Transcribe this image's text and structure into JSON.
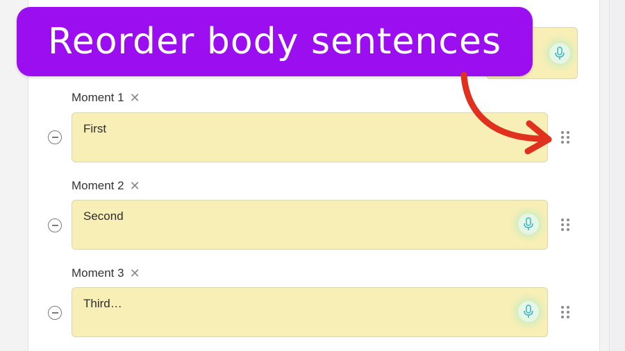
{
  "banner": {
    "title": "Reorder body sentences",
    "color": "#9b0ef0"
  },
  "moments": [
    {
      "label": "Moment 1",
      "text": "First",
      "has_mic": false
    },
    {
      "label": "Moment 2",
      "text": "Second",
      "has_mic": true
    },
    {
      "label": "Moment 3",
      "text": "Third…",
      "has_mic": true
    }
  ],
  "icons": {
    "remove": "close-icon",
    "delete": "minus-circle-icon",
    "mic": "microphone-icon",
    "drag": "drag-handle-icon",
    "arrow": "curved-arrow-icon"
  },
  "colors": {
    "field_bg": "#f8efb6",
    "mic_color": "#3fb8c7",
    "arrow_color": "#e0301e"
  }
}
